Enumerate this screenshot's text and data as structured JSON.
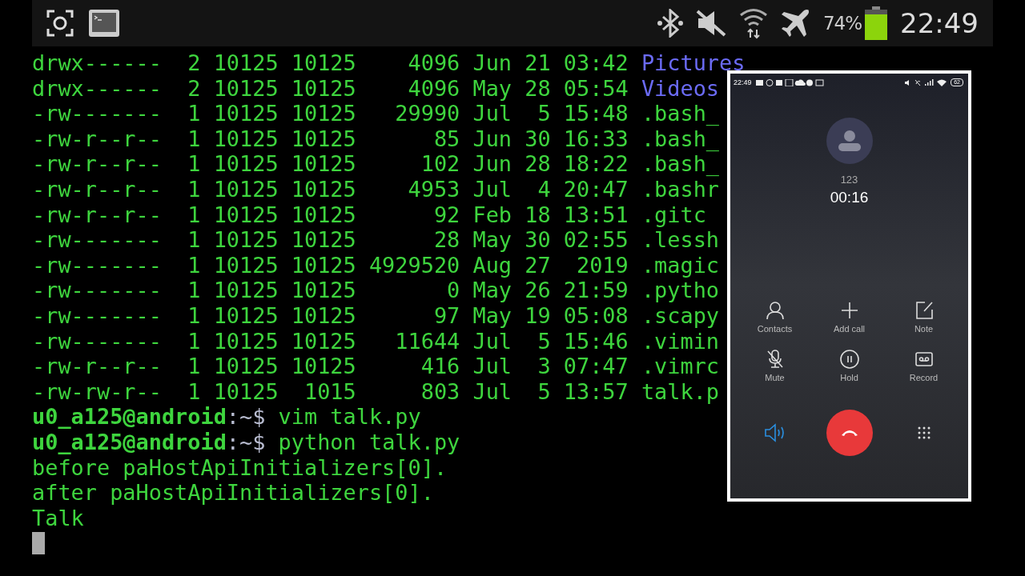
{
  "status_bar": {
    "battery_text": "74%",
    "time": "22:49"
  },
  "terminal": {
    "lines": [
      {
        "kind": "dir",
        "text": "drwx------  2 10125 10125    4096 Jun 21 03:42",
        "name": "Pictures"
      },
      {
        "kind": "dir",
        "text": "drwx------  2 10125 10125    4096 May 28 05:54",
        "name": "Videos"
      },
      {
        "kind": "file",
        "text": "-rw-------  1 10125 10125   29990 Jul  5 15:48",
        "name": ".bash_"
      },
      {
        "kind": "file",
        "text": "-rw-r--r--  1 10125 10125      85 Jun 30 16:33",
        "name": ".bash_"
      },
      {
        "kind": "file",
        "text": "-rw-r--r--  1 10125 10125     102 Jun 28 18:22",
        "name": ".bash_"
      },
      {
        "kind": "file",
        "text": "-rw-r--r--  1 10125 10125    4953 Jul  4 20:47",
        "name": ".bashr"
      },
      {
        "kind": "file",
        "text": "-rw-r--r--  1 10125 10125      92 Feb 18 13:51",
        "name": ".gitc"
      },
      {
        "kind": "file",
        "text": "-rw-------  1 10125 10125      28 May 30 02:55",
        "name": ".lessh"
      },
      {
        "kind": "file",
        "text": "-rw-------  1 10125 10125 4929520 Aug 27  2019",
        "name": ".magic"
      },
      {
        "kind": "file",
        "text": "-rw-------  1 10125 10125       0 May 26 21:59",
        "name": ".pytho"
      },
      {
        "kind": "file",
        "text": "-rw-------  1 10125 10125      97 May 19 05:08",
        "name": ".scapy"
      },
      {
        "kind": "file",
        "text": "-rw-------  1 10125 10125   11644 Jul  5 15:46",
        "name": ".vimin"
      },
      {
        "kind": "file",
        "text": "-rw-r--r--  1 10125 10125     416 Jul  3 07:47",
        "name": ".vimrc"
      },
      {
        "kind": "file",
        "text": "-rw-rw-r--  1 10125  1015     803 Jul  5 13:57",
        "name": "talk.p"
      },
      {
        "kind": "prompt",
        "user": "u0_a125@android",
        "path": ":~$",
        "command": "vim talk.py"
      },
      {
        "kind": "prompt",
        "user": "u0_a125@android",
        "path": ":~$",
        "command": "python talk.py"
      },
      {
        "kind": "output",
        "text": "before paHostApiInitializers[0]."
      },
      {
        "kind": "output",
        "text": "after paHostApiInitializers[0]."
      },
      {
        "kind": "output",
        "text": "Talk"
      },
      {
        "kind": "cursor"
      }
    ]
  },
  "call_screen": {
    "status_time": "22:49",
    "battery": "62",
    "caller": "123",
    "duration": "00:16",
    "actions": [
      {
        "kind": "contacts",
        "label": "Contacts"
      },
      {
        "kind": "add",
        "label": "Add call"
      },
      {
        "kind": "note",
        "label": "Note"
      },
      {
        "kind": "mute",
        "label": "Mute"
      },
      {
        "kind": "hold",
        "label": "Hold"
      },
      {
        "kind": "record",
        "label": "Record"
      }
    ],
    "speaker_on": true
  }
}
